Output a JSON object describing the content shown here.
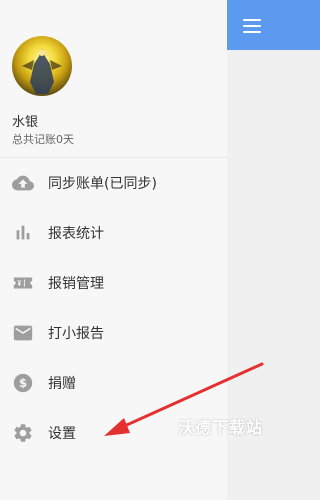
{
  "appbar": {
    "menu_icon": "hamburger-menu-icon",
    "color": "#5b9aee"
  },
  "profile": {
    "avatar": "avatar-image",
    "name": "水银",
    "summary": "总共记账0天"
  },
  "menu": {
    "items": [
      {
        "label": "同步账单(已同步)",
        "icon": "cloud-upload-icon"
      },
      {
        "label": "报表统计",
        "icon": "bar-chart-icon"
      },
      {
        "label": "报销管理",
        "icon": "receipt-icon"
      },
      {
        "label": "打小报告",
        "icon": "mail-icon"
      },
      {
        "label": "捐赠",
        "icon": "dollar-icon"
      },
      {
        "label": "设置",
        "icon": "gear-icon"
      }
    ]
  },
  "overlay": {
    "watermark": "沃德下载站",
    "arrow_color": "#e53030"
  },
  "colors": {
    "icon_gray": "#9e9e9e",
    "text": "#333333"
  }
}
